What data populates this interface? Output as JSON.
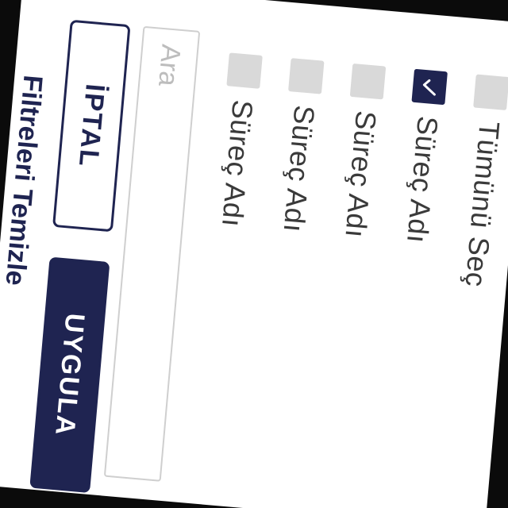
{
  "filter_panel": {
    "select_all_label": "Tümünü Seç",
    "items": [
      {
        "label": "Süreç Adı",
        "checked": true
      },
      {
        "label": "Süreç Adı",
        "checked": false
      },
      {
        "label": "Süreç Adı",
        "checked": false
      },
      {
        "label": "Süreç Adı",
        "checked": false
      }
    ],
    "search_placeholder": "Ara",
    "cancel_label": "İPTAL",
    "apply_label": "UYGULA",
    "footer_title": "Filtreleri Temizle"
  },
  "colors": {
    "primary": "#1f2451",
    "checkbox_unchecked": "#d9d9d9",
    "background": "#ffffff",
    "outer": "#0b0b0b"
  }
}
